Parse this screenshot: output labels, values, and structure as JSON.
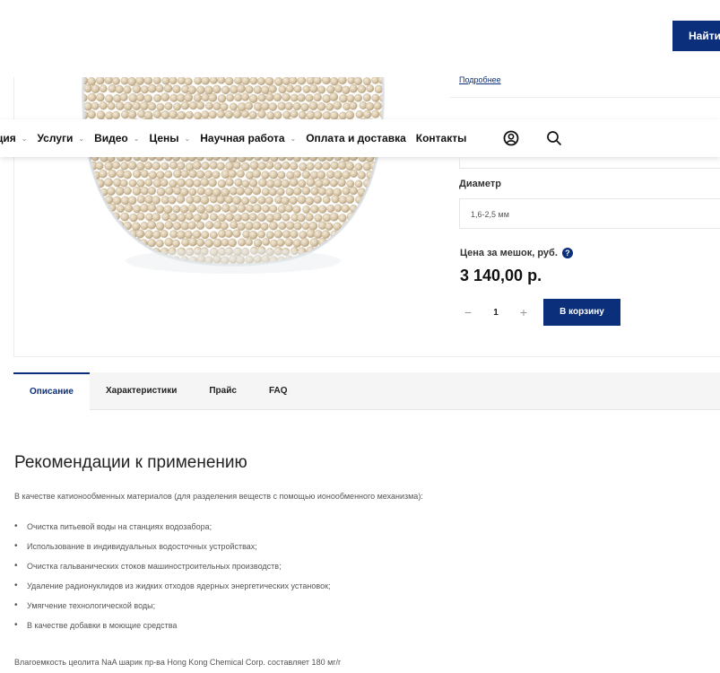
{
  "header": {
    "search_button_label": "Найти"
  },
  "product": {
    "more_link": "Подробнее",
    "diameter_label": "Диаметр",
    "diameter_value": "1,6-2,5 мм",
    "price_label": "Цена за мешок, руб.",
    "help_icon_glyph": "?",
    "price": "3 140,00 р.",
    "quantity": "1",
    "qty_minus": "−",
    "qty_plus": "+",
    "cart_button_label": "В корзину"
  },
  "nav": {
    "items": [
      {
        "label": "ция",
        "has_chevron": true
      },
      {
        "label": "Услуги",
        "has_chevron": true
      },
      {
        "label": "Видео",
        "has_chevron": true
      },
      {
        "label": "Цены",
        "has_chevron": true
      },
      {
        "label": "Научная работа",
        "has_chevron": true
      },
      {
        "label": "Оплата и доставка",
        "has_chevron": false
      },
      {
        "label": "Контакты",
        "has_chevron": false
      }
    ],
    "chevron_glyph": "⌄",
    "icons": [
      "user-icon",
      "search-icon"
    ]
  },
  "tabs": [
    {
      "label": "Описание",
      "active": true
    },
    {
      "label": "Характеристики",
      "active": false
    },
    {
      "label": "Прайс",
      "active": false
    },
    {
      "label": "FAQ",
      "active": false
    }
  ],
  "description": {
    "title": "Рекомендации к применению",
    "intro": "В качестве катионообменных материалов (для разделения веществ с помощью ионообменного механизма):",
    "bullets": [
      "Очистка питьевой воды на станциях водозабора;",
      "Использование в индивидуальных водосточных устройствах;",
      "Очистка гальванических стоков машиностроительных производств;",
      "Удаление радионуклидов из жидких отходов ядерных энергетических установок;",
      "Умягчение технологической воды;",
      "В качестве добавки в моющие средства"
    ],
    "footer": "Влагоемкость цеолита NaA шарик пр-ва Hong Kong Chemical Corp. составляет 180 мг/г"
  },
  "colors": {
    "brand": "#0b2f7a",
    "tab_bar_bg": "#f5f5f5",
    "bead": "#d9c9ad"
  }
}
